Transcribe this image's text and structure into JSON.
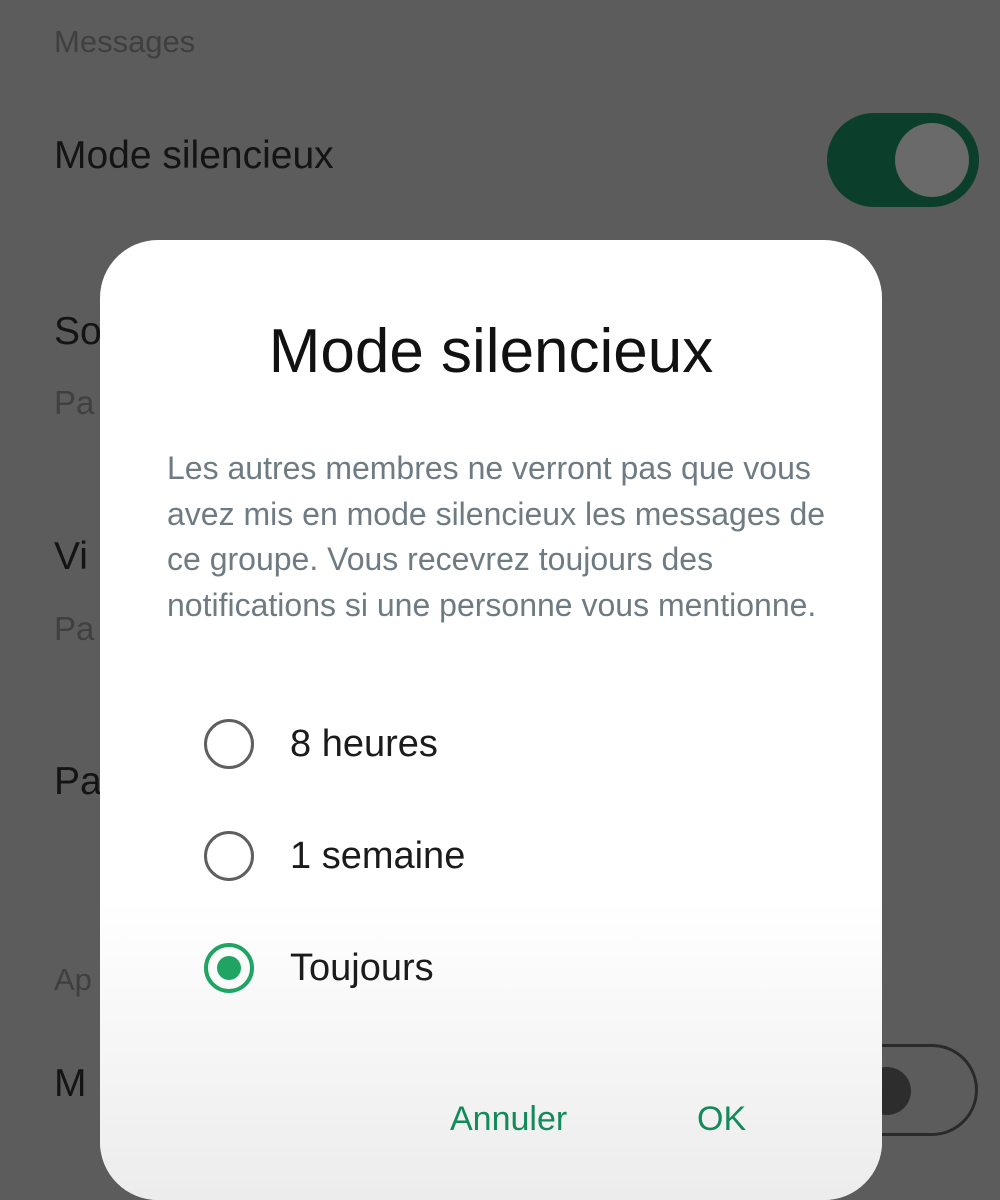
{
  "background": {
    "section_header": "Messages",
    "rows": [
      {
        "title": "Mode silencieux"
      },
      {
        "title": "So",
        "subtitle": "Pa"
      },
      {
        "title": "Vi",
        "subtitle": "Pa"
      },
      {
        "title": "Pa"
      }
    ],
    "section_header_2": "Ap",
    "last_row_title": "M",
    "silent_toggle": {
      "state": "on"
    },
    "last_toggle": {
      "state": "off"
    }
  },
  "dialog": {
    "title": "Mode silencieux",
    "message": "Les autres membres ne verront pas que vous avez mis en mode silencieux les messages de ce groupe. Vous recevrez toujours des notifications si une personne vous mentionne.",
    "options": [
      {
        "label": "8 heures",
        "selected": false
      },
      {
        "label": "1 semaine",
        "selected": false
      },
      {
        "label": "Toujours",
        "selected": true
      }
    ],
    "cancel_label": "Annuler",
    "ok_label": "OK"
  },
  "colors": {
    "accent": "#1fa463",
    "button_text": "#138a5a",
    "toggle_on": "#0c3f2b",
    "overlay_background": "#5c5c5c"
  }
}
